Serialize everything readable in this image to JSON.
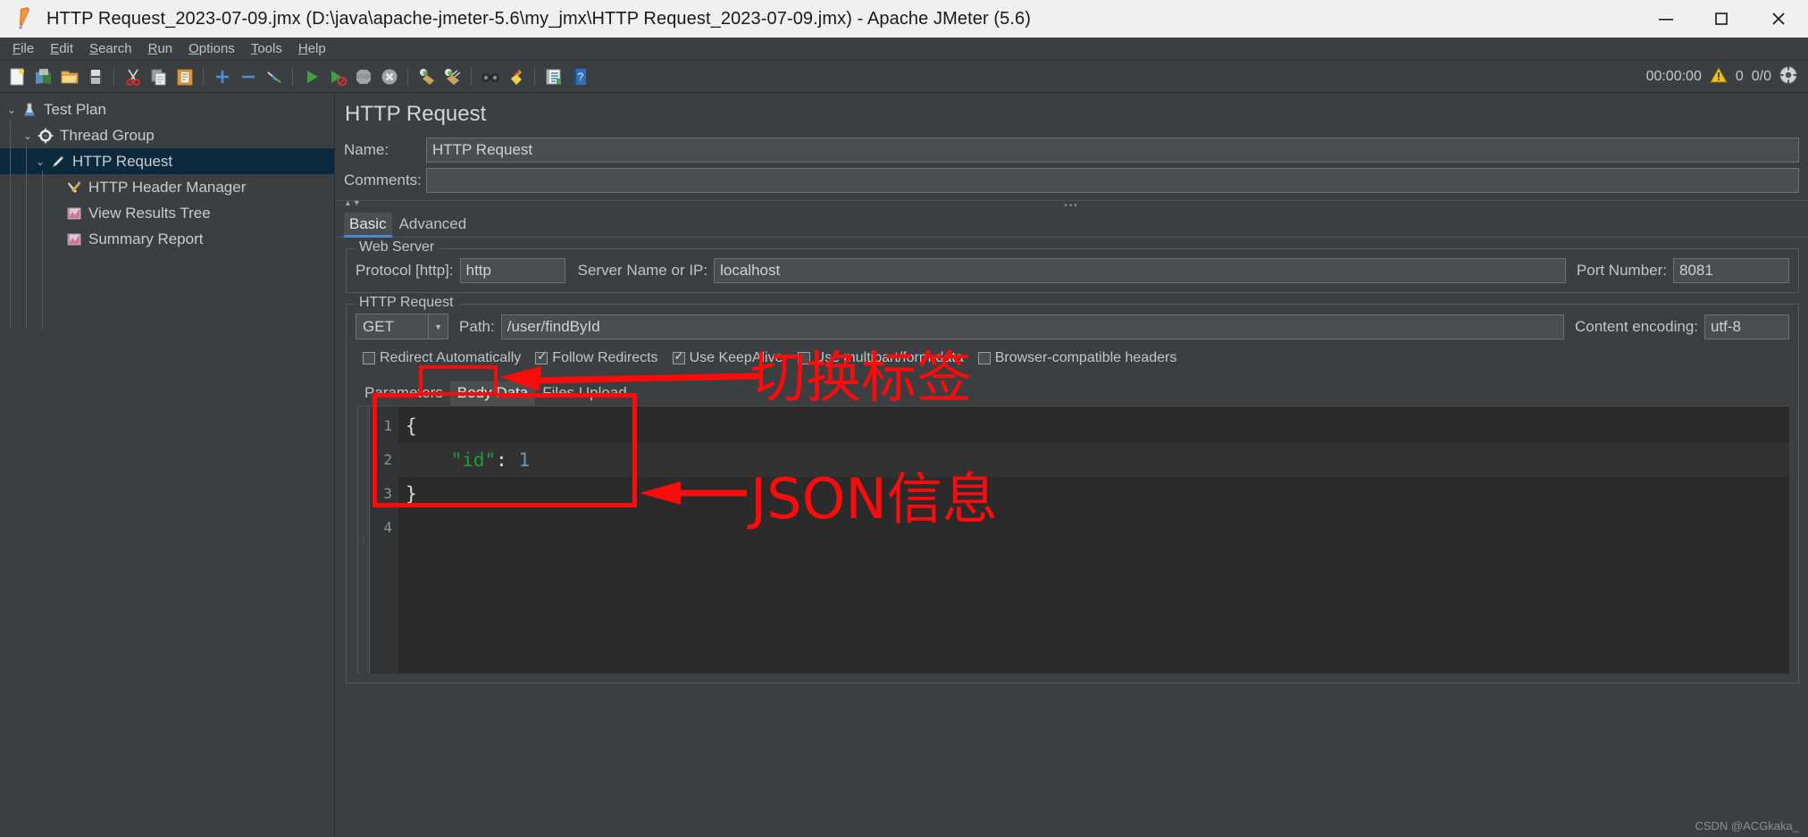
{
  "window": {
    "title": "HTTP Request_2023-07-09.jmx (D:\\java\\apache-jmeter-5.6\\my_jmx\\HTTP Request_2023-07-09.jmx) - Apache JMeter (5.6)",
    "minimize_label": "–",
    "maximize_label": "☐",
    "close_label": "✕"
  },
  "menubar": {
    "items": [
      {
        "label": "File",
        "mnemonic": "F"
      },
      {
        "label": "Edit",
        "mnemonic": "E"
      },
      {
        "label": "Search",
        "mnemonic": "S"
      },
      {
        "label": "Run",
        "mnemonic": "R"
      },
      {
        "label": "Options",
        "mnemonic": "O"
      },
      {
        "label": "Tools",
        "mnemonic": "T"
      },
      {
        "label": "Help",
        "mnemonic": "H"
      }
    ]
  },
  "toolbar": {
    "buttons": [
      {
        "icon": "new-icon",
        "title": "New"
      },
      {
        "icon": "templates-icon",
        "title": "Templates"
      },
      {
        "icon": "open-icon",
        "title": "Open"
      },
      {
        "icon": "save-icon",
        "title": "Save Test Plan"
      },
      {
        "icon": "cut-icon",
        "title": "Cut"
      },
      {
        "icon": "copy-icon",
        "title": "Copy"
      },
      {
        "icon": "paste-icon",
        "title": "Paste"
      },
      {
        "icon": "expand-icon",
        "title": "Expand All"
      },
      {
        "icon": "collapse-icon",
        "title": "Collapse All"
      },
      {
        "icon": "toggle-icon",
        "title": "Toggle"
      },
      {
        "icon": "start-icon",
        "title": "Start"
      },
      {
        "icon": "start-no-pauses-icon",
        "title": "Start no pauses"
      },
      {
        "icon": "stop-icon",
        "title": "Stop"
      },
      {
        "icon": "shutdown-icon",
        "title": "Shutdown"
      },
      {
        "icon": "clear-icon",
        "title": "Clear"
      },
      {
        "icon": "clear-all-icon",
        "title": "Clear All"
      },
      {
        "icon": "search-icon",
        "title": "Search"
      },
      {
        "icon": "reset-search-icon",
        "title": "Reset Search"
      },
      {
        "icon": "function-helper-icon",
        "title": "Function Helper Dialog"
      },
      {
        "icon": "help-icon",
        "title": "Help"
      }
    ],
    "status": {
      "elapsed": "00:00:00",
      "warning_icon": "warning-triangle-icon",
      "warning_count": "0",
      "threads": "0/0",
      "remote_icon": "remote-engines-icon"
    }
  },
  "sidebar": {
    "tree": [
      {
        "label": "Test Plan",
        "depth": 0,
        "icon": "test-plan-icon",
        "expanded": true,
        "selected": false
      },
      {
        "label": "Thread Group",
        "depth": 1,
        "icon": "thread-group-icon",
        "expanded": true,
        "selected": false
      },
      {
        "label": "HTTP Request",
        "depth": 2,
        "icon": "http-request-icon",
        "expanded": true,
        "selected": true
      },
      {
        "label": "HTTP Header Manager",
        "depth": 3,
        "icon": "header-manager-icon",
        "expanded": null,
        "selected": false
      },
      {
        "label": "View Results Tree",
        "depth": 3,
        "icon": "view-results-tree-icon",
        "expanded": null,
        "selected": false
      },
      {
        "label": "Summary Report",
        "depth": 3,
        "icon": "summary-report-icon",
        "expanded": null,
        "selected": false
      }
    ]
  },
  "panel": {
    "title": "HTTP Request",
    "name_label": "Name:",
    "name_value": "HTTP Request",
    "comments_label": "Comments:",
    "comments_value": "",
    "tabs": [
      {
        "label": "Basic",
        "active": true
      },
      {
        "label": "Advanced",
        "active": false
      }
    ],
    "web_server": {
      "legend": "Web Server",
      "protocol_label": "Protocol [http]:",
      "protocol_value": "http",
      "server_label": "Server Name or IP:",
      "server_value": "localhost",
      "port_label": "Port Number:",
      "port_value": "8081"
    },
    "http_request": {
      "legend": "HTTP Request",
      "method_value": "GET",
      "path_label": "Path:",
      "path_value": "/user/findById",
      "encoding_label": "Content encoding:",
      "encoding_value": "utf-8",
      "checkboxes": [
        {
          "label": "Redirect Automatically",
          "checked": false
        },
        {
          "label": "Follow Redirects",
          "checked": true
        },
        {
          "label": "Use KeepAlive",
          "checked": true
        },
        {
          "label": "Use multipart/form-data",
          "checked": false
        },
        {
          "label": "Browser-compatible headers",
          "checked": false
        }
      ]
    },
    "body_tabs": [
      {
        "label": "Parameters",
        "active": false
      },
      {
        "label": "Body Data",
        "active": true
      },
      {
        "label": "Files Upload",
        "active": false
      }
    ],
    "editor": {
      "line_numbers": [
        "1",
        "2",
        "3",
        "4"
      ],
      "lines": [
        {
          "no": "1",
          "tokens": [
            {
              "t": "{",
              "c": "punct"
            }
          ]
        },
        {
          "no": "2",
          "tokens": [
            {
              "t": "    ",
              "c": "punct"
            },
            {
              "t": "\"id\"",
              "c": "key"
            },
            {
              "t": ": ",
              "c": "punct"
            },
            {
              "t": "1",
              "c": "num"
            }
          ]
        },
        {
          "no": "3",
          "tokens": [
            {
              "t": "}",
              "c": "punct"
            }
          ]
        },
        {
          "no": "4",
          "tokens": [
            {
              "t": "",
              "c": "punct"
            }
          ]
        }
      ]
    }
  },
  "annotations": {
    "color": "#fb0b0b",
    "label_switch_tab": "切换标签",
    "label_json_info": "JSON信息"
  },
  "watermark": "CSDN @ACGkaka_"
}
